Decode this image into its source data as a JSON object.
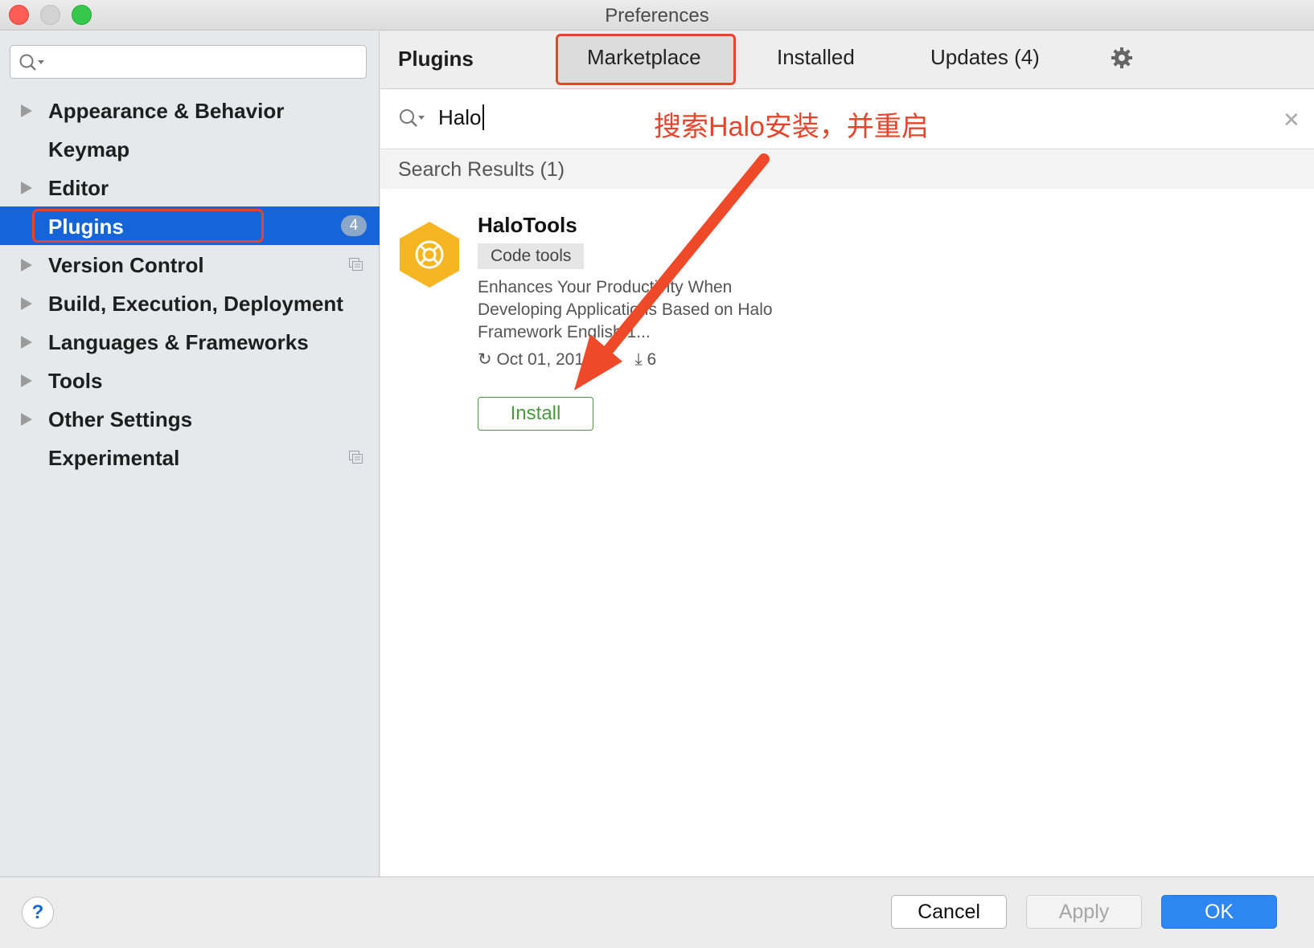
{
  "window": {
    "title": "Preferences"
  },
  "sidebar": {
    "search": {
      "value": "",
      "placeholder": ""
    },
    "items": [
      {
        "label": "Appearance & Behavior",
        "expandable": true
      },
      {
        "label": "Keymap",
        "expandable": false
      },
      {
        "label": "Editor",
        "expandable": true
      },
      {
        "label": "Plugins",
        "expandable": false,
        "selected": true,
        "badge": "4"
      },
      {
        "label": "Version Control",
        "expandable": true,
        "project_icon": true
      },
      {
        "label": "Build, Execution, Deployment",
        "expandable": true
      },
      {
        "label": "Languages & Frameworks",
        "expandable": true
      },
      {
        "label": "Tools",
        "expandable": true
      },
      {
        "label": "Other Settings",
        "expandable": true
      },
      {
        "label": "Experimental",
        "expandable": false,
        "project_icon": true
      }
    ]
  },
  "main": {
    "title": "Plugins",
    "tabs": [
      {
        "label": "Marketplace",
        "active": true
      },
      {
        "label": "Installed"
      },
      {
        "label": "Updates (4)"
      }
    ],
    "search": {
      "value": "Halo"
    },
    "annotation": "搜索Halo安装，并重启",
    "results_header": "Search Results (1)",
    "plugin": {
      "name": "HaloTools",
      "tag": "Code tools",
      "description": "Enhances Your Productivity When Developing Applications Based on Halo Framework English 1...",
      "date": "Oct 01, 2019",
      "downloads": "6",
      "install_label": "Install"
    }
  },
  "footer": {
    "help_label": "?",
    "cancel_label": "Cancel",
    "apply_label": "Apply",
    "ok_label": "OK"
  },
  "colors": {
    "accent": "#1565d8",
    "annotation": "#e8442b",
    "install_green": "#4a9a40",
    "ok_blue": "#2d86f2",
    "plugin_logo": "#f6b622"
  }
}
